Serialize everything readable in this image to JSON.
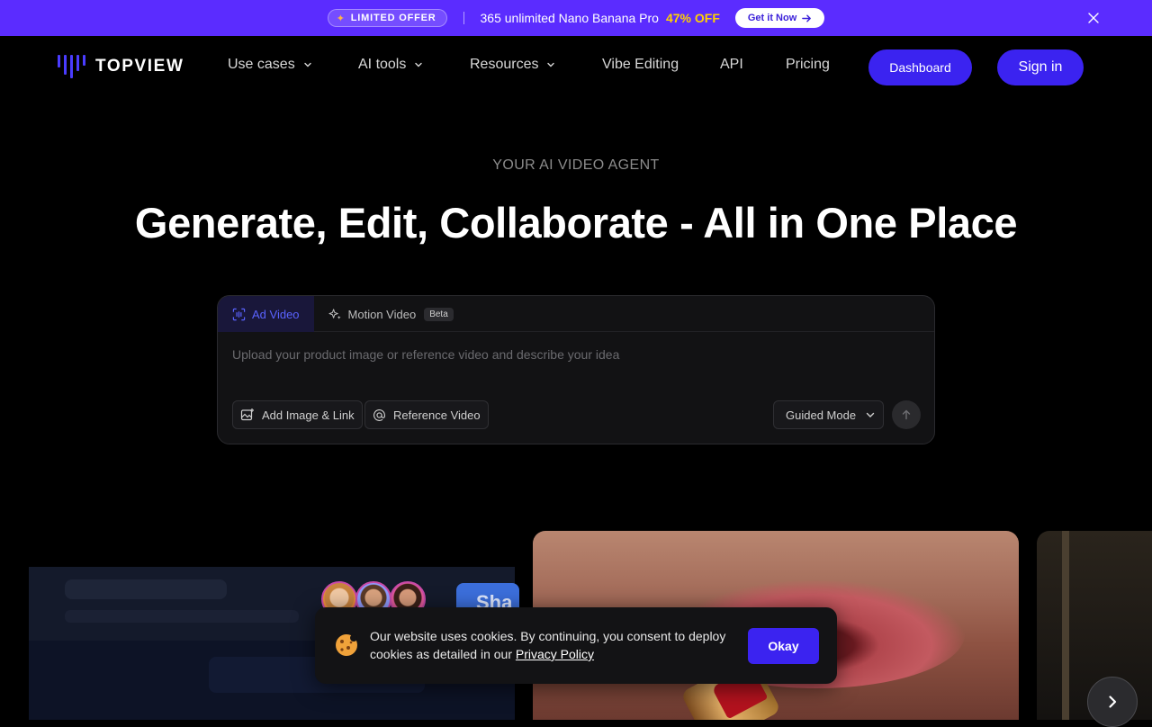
{
  "promo": {
    "badge": "LIMITED OFFER",
    "text": "365 unlimited Nano Banana Pro",
    "discount": "47% OFF",
    "cta": "Get it Now"
  },
  "nav": {
    "logo": "TOPVIEW",
    "items": [
      "Use cases",
      "AI tools",
      "Resources",
      "Vibe Editing",
      "API",
      "Pricing"
    ],
    "dashboard": "Dashboard",
    "signin": "Sign in"
  },
  "hero": {
    "eyebrow": "YOUR AI VIDEO AGENT",
    "headline": "Generate, Edit, Collaborate - All in One Place"
  },
  "composer": {
    "tabs": [
      {
        "label": "Ad Video",
        "active": true
      },
      {
        "label": "Motion Video",
        "badge": "Beta",
        "active": false
      }
    ],
    "placeholder": "Upload your product image or reference video and describe your idea",
    "add_image": "Add Image & Link",
    "reference_video": "Reference Video",
    "mode": "Guided Mode"
  },
  "showcase": {
    "share_text": "Sha"
  },
  "cookie": {
    "text": "Our website uses cookies. By continuing, you consent to deploy cookies as detailed in our",
    "link": "Privacy Policy",
    "button": "Okay"
  },
  "colors": {
    "promo_bg": "#5b2cff",
    "accent": "#3b23f0",
    "discount": "#ffd200",
    "active_tab_text": "#5a63ff"
  },
  "icons": [
    "sparkle-icon",
    "arrow-right-icon",
    "close-icon",
    "chevron-down-icon",
    "ad-video-icon",
    "motion-sparkle-icon",
    "add-image-icon",
    "at-icon",
    "arrow-up-icon",
    "cookie-icon",
    "chevron-right-icon"
  ]
}
